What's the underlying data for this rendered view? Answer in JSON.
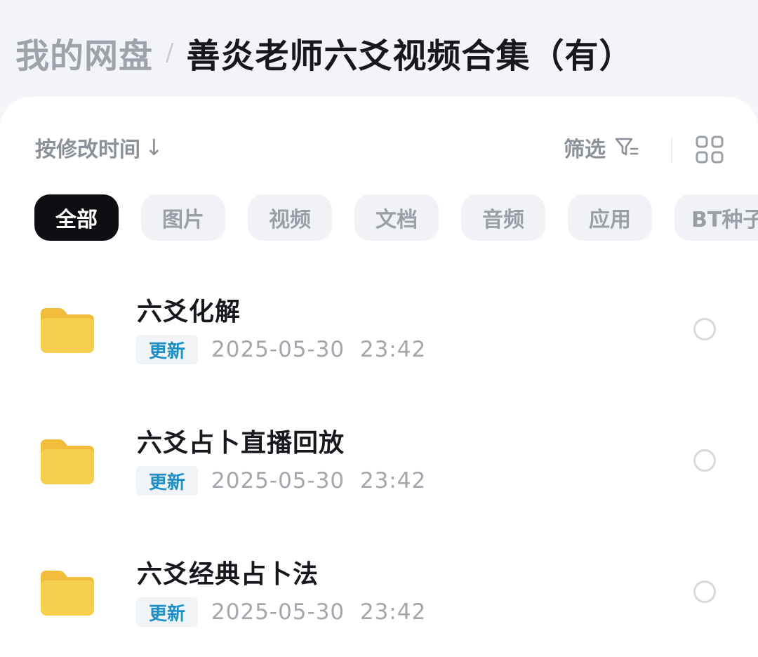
{
  "breadcrumb": {
    "root": "我的网盘",
    "separator": "/",
    "current": "善炎老师六爻视频合集（有）"
  },
  "toolbar": {
    "sort_label": "按修改时间",
    "sort_arrow": "↓",
    "filter_label": "筛选",
    "filter_icon": "filter-icon",
    "view_icon": "grid-view-icon"
  },
  "categories": [
    {
      "label": "全部",
      "active": true
    },
    {
      "label": "图片",
      "active": false
    },
    {
      "label": "视频",
      "active": false
    },
    {
      "label": "文档",
      "active": false
    },
    {
      "label": "音频",
      "active": false
    },
    {
      "label": "应用",
      "active": false
    },
    {
      "label": "BT种子",
      "active": false
    }
  ],
  "files": [
    {
      "name": "六爻化解",
      "badge": "更新",
      "time": "2025-05-30  23:42",
      "icon": "folder-icon"
    },
    {
      "name": "六爻占卜直播回放",
      "badge": "更新",
      "time": "2025-05-30  23:42",
      "icon": "folder-icon"
    },
    {
      "name": "六爻经典占卜法",
      "badge": "更新",
      "time": "2025-05-30  23:42",
      "icon": "folder-icon"
    }
  ],
  "colors": {
    "active_chip_bg": "#0e0f13",
    "badge_text": "#1e8fc4",
    "folder": "#f7c948"
  }
}
